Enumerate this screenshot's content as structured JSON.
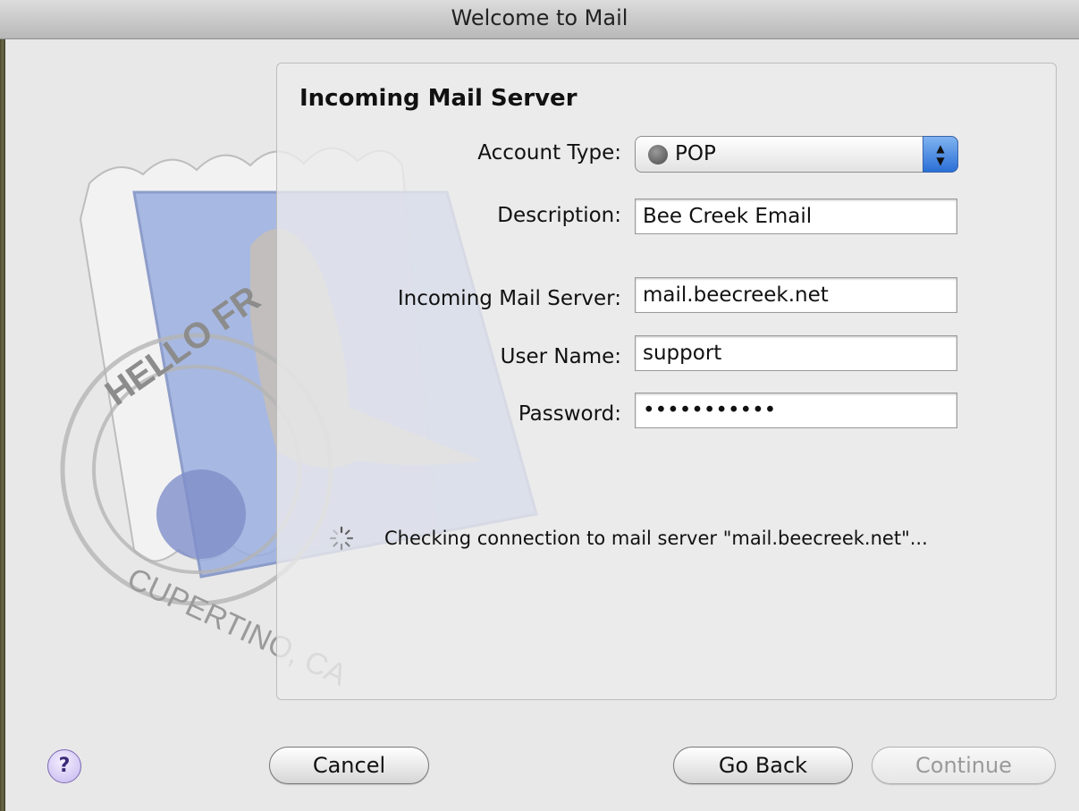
{
  "window": {
    "title": "Welcome to Mail"
  },
  "section": {
    "title": "Incoming Mail Server"
  },
  "form": {
    "account_type_label": "Account Type:",
    "account_type_value": "POP",
    "description_label": "Description:",
    "description_value": "Bee Creek Email",
    "incoming_server_label": "Incoming Mail Server:",
    "incoming_server_value": "mail.beecreek.net",
    "username_label": "User Name:",
    "username_value": "support",
    "password_label": "Password:",
    "password_value": "•••••••••••"
  },
  "status": {
    "message": "Checking connection to mail server \"mail.beecreek.net\"..."
  },
  "buttons": {
    "help": "?",
    "cancel": "Cancel",
    "go_back": "Go Back",
    "continue": "Continue"
  },
  "stamp_art": {
    "text_top": "HELLO FR",
    "text_bottom": "CUPERTINO, CA"
  },
  "colors": {
    "accent": "#2b6fd6",
    "help": "#7c6bb3"
  },
  "icons": {
    "popup": "globe-icon",
    "stepper": "updown-arrows-icon",
    "spinner": "progress-spinner-icon"
  }
}
